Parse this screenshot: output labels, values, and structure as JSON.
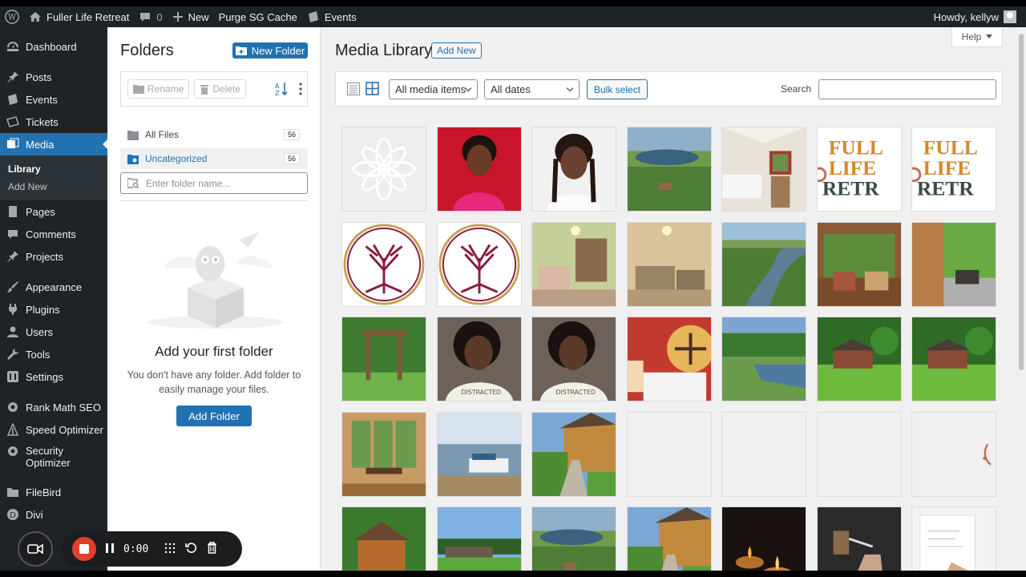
{
  "adminbar": {
    "site_name": "Fuller Life Retreat",
    "comments_count": "0",
    "new_label": "New",
    "purge_label": "Purge SG Cache",
    "events_label": "Events",
    "howdy": "Howdy, kellyw"
  },
  "sidebar": {
    "items": [
      {
        "label": "Dashboard",
        "icon": "dashboard-icon"
      },
      {
        "label": "Posts",
        "icon": "pin-icon"
      },
      {
        "label": "Events",
        "icon": "calendar-icon"
      },
      {
        "label": "Tickets",
        "icon": "ticket-icon"
      },
      {
        "label": "Media",
        "icon": "media-icon"
      },
      {
        "label": "Pages",
        "icon": "page-icon"
      },
      {
        "label": "Comments",
        "icon": "comment-icon"
      },
      {
        "label": "Projects",
        "icon": "pin-icon"
      },
      {
        "label": "Appearance",
        "icon": "brush-icon"
      },
      {
        "label": "Plugins",
        "icon": "plug-icon"
      },
      {
        "label": "Users",
        "icon": "user-icon"
      },
      {
        "label": "Tools",
        "icon": "wrench-icon"
      },
      {
        "label": "Settings",
        "icon": "settings-icon"
      },
      {
        "label": "Rank Math SEO",
        "icon": "gear-icon"
      },
      {
        "label": "Speed Optimizer",
        "icon": "speed-icon"
      },
      {
        "label": "Security Optimizer",
        "icon": "gear-icon"
      },
      {
        "label": "FileBird",
        "icon": "folder-icon"
      },
      {
        "label": "Divi",
        "icon": "divi-icon"
      }
    ],
    "submenu": {
      "library": "Library",
      "add_new": "Add New"
    }
  },
  "folders": {
    "title": "Folders",
    "new_folder": "New Folder",
    "rename": "Rename",
    "delete": "Delete",
    "all_files": "All Files",
    "all_files_count": "56",
    "uncategorized": "Uncategorized",
    "uncategorized_count": "56",
    "search_placeholder": "Enter folder name...",
    "empty_title": "Add your first folder",
    "empty_desc": "You don't have any folder. Add folder to easily manage your files.",
    "add_folder": "Add Folder"
  },
  "media": {
    "title": "Media Library",
    "add_new": "Add New",
    "help": "Help",
    "filter_type": "All media items",
    "filter_date": "All dates",
    "bulk_select": "Bulk select",
    "search_label": "Search"
  },
  "thumbnails": [
    "flower-outline",
    "woman-red-background",
    "woman-smiling",
    "aerial-lake",
    "bedroom-window",
    "full-life-logo",
    "full-life-logo",
    "tree-logo",
    "tree-logo",
    "living-room-green",
    "living-room-beige",
    "aerial-river",
    "screened-porch",
    "patio-furniture",
    "garden-arbor",
    "woman-selfie",
    "woman-selfie",
    "bed-red-wall",
    "river-trees",
    "house-lawn",
    "house-lawn",
    "sunroom-table",
    "boat-dock",
    "garden-path-house",
    "blank",
    "blank",
    "blank",
    "partial-logo",
    "house-yard",
    "lawn-house",
    "aerial-lake",
    "garden-path-house",
    "candles",
    "hands-jar",
    "writing-hand"
  ],
  "recorder": {
    "time": "0:00"
  },
  "colors": {
    "accent": "#2271b1",
    "adminbar": "#1d2327",
    "record": "#e0412f"
  }
}
